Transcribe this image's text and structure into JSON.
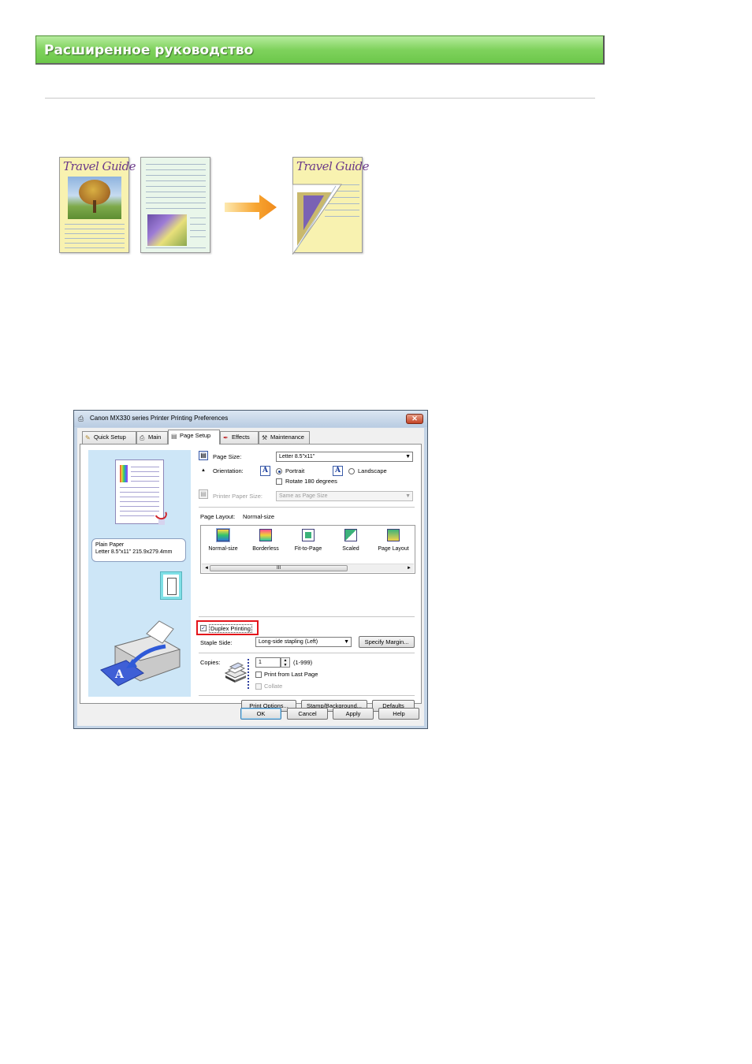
{
  "header": {
    "title": "Расширенное руководство"
  },
  "illustration": {
    "page1_title": "Travel Guide",
    "page3_title": "Travel Guide"
  },
  "dialog": {
    "title": "Canon MX330 series Printer Printing Preferences",
    "close": "✕",
    "tabs": [
      {
        "label": "Quick Setup",
        "icon": "quick-setup-icon"
      },
      {
        "label": "Main",
        "icon": "main-icon"
      },
      {
        "label": "Page Setup",
        "icon": "page-setup-icon",
        "active": true
      },
      {
        "label": "Effects",
        "icon": "effects-icon"
      },
      {
        "label": "Maintenance",
        "icon": "maintenance-icon"
      }
    ],
    "preview": {
      "info_line1": "Plain Paper",
      "info_line2": "Letter 8.5\"x11\" 215.9x279.4mm"
    },
    "page_size": {
      "label": "Page Size:",
      "value": "Letter 8.5\"x11\""
    },
    "orientation": {
      "label": "Orientation:",
      "icon_glyph": "A",
      "portrait": "Portrait",
      "landscape": "Landscape",
      "selected": "Portrait",
      "rotate_label": "Rotate 180 degrees",
      "rotate_checked": false
    },
    "printer_paper_size": {
      "label": "Printer Paper Size:",
      "value": "Same as Page Size",
      "disabled": true
    },
    "page_layout": {
      "label": "Page Layout:",
      "value": "Normal-size",
      "items": [
        {
          "label": "Normal-size",
          "selected": true
        },
        {
          "label": "Borderless"
        },
        {
          "label": "Fit-to-Page"
        },
        {
          "label": "Scaled"
        },
        {
          "label": "Page Layout"
        }
      ],
      "scroll_left": "◄",
      "scroll_right": "►",
      "scroll_grip": "III"
    },
    "duplex": {
      "label": "Duplex Printing",
      "checked": true,
      "check_glyph": "✓"
    },
    "staple_side": {
      "label": "Staple Side:",
      "value": "Long-side stapling (Left)"
    },
    "specify_margin": "Specify Margin...",
    "copies": {
      "label": "Copies:",
      "value": "1",
      "range": "(1-999)",
      "print_from_last": "Print from Last Page",
      "print_from_last_checked": false,
      "collate": "Collate",
      "collate_checked": false,
      "collate_disabled": true
    },
    "bottom_buttons": {
      "print_options": "Print Options...",
      "stamp_background": "Stamp/Background...",
      "defaults": "Defaults"
    },
    "footer_buttons": {
      "ok": "OK",
      "cancel": "Cancel",
      "apply": "Apply",
      "help": "Help"
    }
  },
  "colors": {
    "banner_green": "#7fd25d",
    "dialog_frame": "#c4d4e6",
    "preview_bg": "#cde6f7",
    "highlight_red": "#e4141b"
  }
}
